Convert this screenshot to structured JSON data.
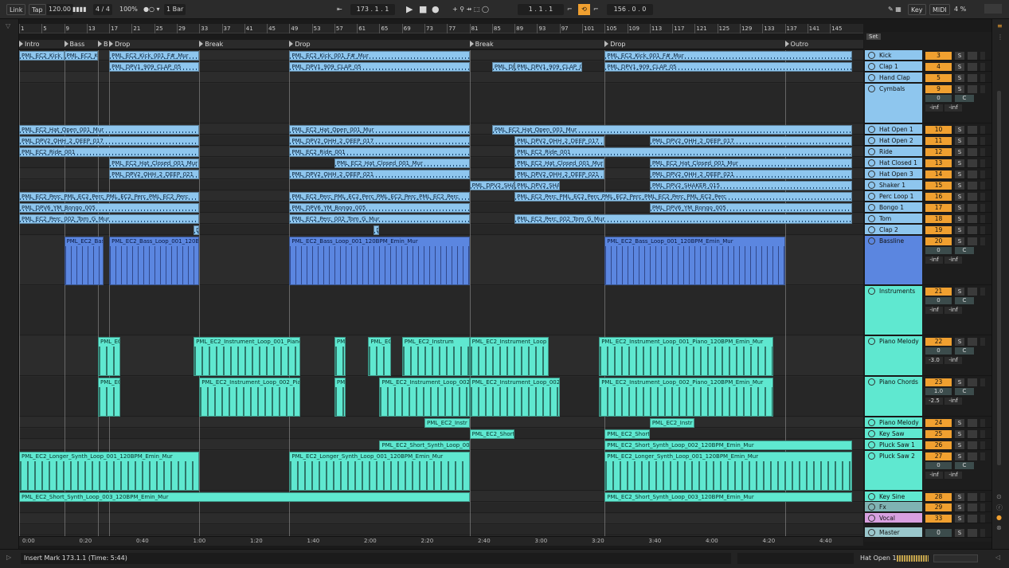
{
  "topbar": {
    "link": "Link",
    "tap": "Tap",
    "tempo": "120.00",
    "signature": "4 / 4",
    "zoom": "100%",
    "quant": "1 Bar",
    "position": "173 .  1 .  1",
    "loop_start": "1 .  1 .  1",
    "loop_len": "156 .  0 .  0",
    "key": "Key",
    "midi": "MIDI",
    "cpu": "4 %"
  },
  "ruler": {
    "bars": [
      "1",
      "5",
      "9",
      "13",
      "17",
      "21",
      "25",
      "29",
      "33",
      "37",
      "41",
      "45",
      "49",
      "53",
      "57",
      "61",
      "65",
      "69",
      "73",
      "77",
      "81",
      "85",
      "89",
      "93",
      "97",
      "101",
      "105",
      "109",
      "113",
      "117",
      "121",
      "125",
      "129",
      "133",
      "137",
      "141",
      "145"
    ]
  },
  "locators": [
    {
      "label": "Intro",
      "bar": 1
    },
    {
      "label": "Bass",
      "bar": 9
    },
    {
      "label": "B",
      "bar": 15
    },
    {
      "label": "Drop",
      "bar": 17
    },
    {
      "label": "Break",
      "bar": 33
    },
    {
      "label": "Drop",
      "bar": 49
    },
    {
      "label": "Break",
      "bar": 81
    },
    {
      "label": "Drop",
      "bar": 105
    },
    {
      "label": "Outro",
      "bar": 137
    }
  ],
  "time_axis": [
    "0:00",
    "0:20",
    "0:40",
    "1:00",
    "1:20",
    "1:40",
    "2:00",
    "2:20",
    "2:40",
    "3:00",
    "3:20",
    "3:40",
    "4:00",
    "4:20",
    "4:40"
  ],
  "clips": [
    {
      "lane": 0,
      "from": 1,
      "to": 9,
      "name": "PML_EC2_Kick",
      "kind": "blue"
    },
    {
      "lane": 0,
      "from": 9,
      "to": 15,
      "name": "PML_EC2_K",
      "kind": "blue"
    },
    {
      "lane": 0,
      "from": 17,
      "to": 33,
      "name": "PML_EC2_Kick_001_F#_Mur",
      "kind": "blue"
    },
    {
      "lane": 0,
      "from": 49,
      "to": 81,
      "name": "PML_EC2_Kick_001_F#_Mur",
      "kind": "blue"
    },
    {
      "lane": 0,
      "from": 105,
      "to": 149,
      "name": "PML_EC2_Kick_001_F#_Mur",
      "kind": "blue"
    },
    {
      "lane": 1,
      "from": 17,
      "to": 33,
      "name": "PML_DPV1_909_CLAP_05",
      "kind": "blue"
    },
    {
      "lane": 1,
      "from": 49,
      "to": 81,
      "name": "PML_DPV1_909_CLAP_05",
      "kind": "blue"
    },
    {
      "lane": 1,
      "from": 85,
      "to": 89,
      "name": "PML_DPV1_909_CLAP_05",
      "kind": "blue"
    },
    {
      "lane": 1,
      "from": 89,
      "to": 101,
      "name": "PML_DPV1_909_CLAP_05",
      "kind": "blue"
    },
    {
      "lane": 1,
      "from": 105,
      "to": 149,
      "name": "PML_DPV1_909_CLAP_05",
      "kind": "blue"
    },
    {
      "lane": 4,
      "from": 1,
      "to": 33,
      "name": "PML_EC2_Hat_Open_001_Mur",
      "kind": "blue"
    },
    {
      "lane": 4,
      "from": 49,
      "to": 81,
      "name": "PML_EC2_Hat_Open_001_Mur",
      "kind": "blue"
    },
    {
      "lane": 4,
      "from": 85,
      "to": 149,
      "name": "PML_EC2_Hat_Open_001_Mur",
      "kind": "blue"
    },
    {
      "lane": 5,
      "from": 1,
      "to": 33,
      "name": "PML_DPV2_OHH_2_DEEP_017",
      "kind": "blue"
    },
    {
      "lane": 5,
      "from": 49,
      "to": 81,
      "name": "PML_DPV2_OHH_2_DEEP_017",
      "kind": "blue"
    },
    {
      "lane": 5,
      "from": 89,
      "to": 105,
      "name": "PML_DPV2_OHH_2_DEEP_017",
      "kind": "blue"
    },
    {
      "lane": 5,
      "from": 113,
      "to": 149,
      "name": "PML_DPV2_OHH_2_DEEP_017",
      "kind": "blue"
    },
    {
      "lane": 6,
      "from": 1,
      "to": 33,
      "name": "PML_EC2_Ride_001",
      "kind": "blue"
    },
    {
      "lane": 6,
      "from": 49,
      "to": 81,
      "name": "PML_EC2_Ride_001",
      "kind": "blue"
    },
    {
      "lane": 6,
      "from": 89,
      "to": 149,
      "name": "PML_EC2_Ride_001",
      "kind": "blue"
    },
    {
      "lane": 7,
      "from": 17,
      "to": 33,
      "name": "PML_EC2_Hat_Closed_001_Mur",
      "kind": "blue"
    },
    {
      "lane": 7,
      "from": 57,
      "to": 81,
      "name": "PML_EC2_Hat_Closed_001_Mur",
      "kind": "blue"
    },
    {
      "lane": 7,
      "from": 89,
      "to": 105,
      "name": "PML_EC2_Hat_Closed_001_Mur",
      "kind": "blue"
    },
    {
      "lane": 7,
      "from": 113,
      "to": 149,
      "name": "PML_EC2_Hat_Closed_001_Mur",
      "kind": "blue"
    },
    {
      "lane": 8,
      "from": 17,
      "to": 33,
      "name": "PML_DPV2_OHH_2_DEEP_021",
      "kind": "blue"
    },
    {
      "lane": 8,
      "from": 49,
      "to": 81,
      "name": "PML_DPV2_OHH_2_DEEP_021",
      "kind": "blue"
    },
    {
      "lane": 8,
      "from": 89,
      "to": 105,
      "name": "PML_DPV2_OHH_2_DEEP_021",
      "kind": "blue"
    },
    {
      "lane": 8,
      "from": 113,
      "to": 149,
      "name": "PML_DPV2_OHH_2_DEEP_021",
      "kind": "blue"
    },
    {
      "lane": 9,
      "from": 81,
      "to": 89,
      "name": "PML_DPV2_SHA",
      "kind": "blue"
    },
    {
      "lane": 9,
      "from": 89,
      "to": 97,
      "name": "PML_DPV2_SHA",
      "kind": "blue"
    },
    {
      "lane": 9,
      "from": 113,
      "to": 149,
      "name": "PML_DPV2_SHAKER_015",
      "kind": "blue"
    },
    {
      "lane": 10,
      "from": 1,
      "to": 33,
      "name": "PML_EC2_Perc_PML_EC2_Perc_PML_EC2_Perc_PML_EC2_Perc",
      "kind": "blue"
    },
    {
      "lane": 10,
      "from": 49,
      "to": 81,
      "name": "PML_EC2_Perc_PML_EC2_Perc_PML_EC2_Perc_PML_EC2_Perc",
      "kind": "blue"
    },
    {
      "lane": 10,
      "from": 89,
      "to": 149,
      "name": "PML_EC2_Perc_PML_EC2_Perc_PML_EC2_Perc_PML_EC2_Perc_PML_EC2_Perc",
      "kind": "blue"
    },
    {
      "lane": 11,
      "from": 1,
      "to": 33,
      "name": "PML_DPV6_YM_Bongo_005",
      "kind": "blue"
    },
    {
      "lane": 11,
      "from": 49,
      "to": 81,
      "name": "PML_DPV6_YM_Bongo_005",
      "kind": "blue"
    },
    {
      "lane": 11,
      "from": 113,
      "to": 149,
      "name": "PML_DPV6_YM_Bongo_005",
      "kind": "blue"
    },
    {
      "lane": 12,
      "from": 1,
      "to": 33,
      "name": "PML_EC2_Perc_002_Tom_G_Mur",
      "kind": "blue"
    },
    {
      "lane": 12,
      "from": 49,
      "to": 81,
      "name": "PML_EC2_Perc_002_Tom_G_Mur",
      "kind": "blue"
    },
    {
      "lane": 12,
      "from": 89,
      "to": 149,
      "name": "PML_EC2_Perc_002_Tom_G_Mur",
      "kind": "blue"
    },
    {
      "lane": 13,
      "from": 32,
      "to": 33,
      "name": "D",
      "kind": "blue"
    },
    {
      "lane": 13,
      "from": 64,
      "to": 65,
      "name": "D",
      "kind": "blue"
    },
    {
      "lane": 14,
      "from": 9,
      "to": 16,
      "name": "PML_EC2_Bas",
      "kind": "bass"
    },
    {
      "lane": 14,
      "from": 17,
      "to": 33,
      "name": "PML_EC2_Bass_Loop_001_120BPM",
      "kind": "bass"
    },
    {
      "lane": 14,
      "from": 49,
      "to": 81,
      "name": "PML_EC2_Bass_Loop_001_120BPM_Emin_Mur",
      "kind": "bass"
    },
    {
      "lane": 14,
      "from": 105,
      "to": 137,
      "name": "PML_EC2_Bass_Loop_001_120BPM_Emin_Mur",
      "kind": "bass"
    },
    {
      "lane": 16,
      "from": 15,
      "to": 19,
      "name": "PML_EC",
      "kind": "teal"
    },
    {
      "lane": 16,
      "from": 32,
      "to": 51,
      "name": "PML_EC2_Instrument_Loop_001_Piano",
      "kind": "teal"
    },
    {
      "lane": 16,
      "from": 57,
      "to": 59,
      "name": "PMI",
      "kind": "teal"
    },
    {
      "lane": 16,
      "from": 63,
      "to": 67,
      "name": "PML_EC",
      "kind": "teal"
    },
    {
      "lane": 16,
      "from": 69,
      "to": 81,
      "name": "PML_EC2_Instrum",
      "kind": "teal"
    },
    {
      "lane": 16,
      "from": 81,
      "to": 95,
      "name": "PML_EC2_Instrument_Loop",
      "kind": "teal"
    },
    {
      "lane": 16,
      "from": 104,
      "to": 135,
      "name": "PML_EC2_Instrument_Loop_001_Piano_120BPM_Emin_Mur",
      "kind": "teal"
    },
    {
      "lane": 17,
      "from": 15,
      "to": 19,
      "name": "PML_EC",
      "kind": "teal"
    },
    {
      "lane": 17,
      "from": 33,
      "to": 51,
      "name": "PML_EC2_Instrument_Loop_002_Pia",
      "kind": "teal"
    },
    {
      "lane": 17,
      "from": 57,
      "to": 59,
      "name": "PMI",
      "kind": "teal"
    },
    {
      "lane": 17,
      "from": 65,
      "to": 81,
      "name": "PML_EC2_Instrument_Loop_002",
      "kind": "teal"
    },
    {
      "lane": 17,
      "from": 81,
      "to": 97,
      "name": "PML_EC2_Instrument_Loop_002",
      "kind": "teal"
    },
    {
      "lane": 17,
      "from": 104,
      "to": 135,
      "name": "PML_EC2_Instrument_Loop_002_Piano_120BPM_Emin_Mur",
      "kind": "teal"
    },
    {
      "lane": 18,
      "from": 73,
      "to": 81,
      "name": "PML_EC2_Instr",
      "kind": "teal"
    },
    {
      "lane": 18,
      "from": 113,
      "to": 121,
      "name": "PML_EC2_Instr",
      "kind": "teal"
    },
    {
      "lane": 19,
      "from": 81,
      "to": 89,
      "name": "PML_EC2_Short",
      "kind": "teal"
    },
    {
      "lane": 19,
      "from": 105,
      "to": 113,
      "name": "PML_EC2_Short",
      "kind": "teal"
    },
    {
      "lane": 20,
      "from": 65,
      "to": 81,
      "name": "PML_EC2_Short_Synth_Loop_00",
      "kind": "teal"
    },
    {
      "lane": 20,
      "from": 105,
      "to": 149,
      "name": "PML_EC2_Short_Synth_Loop_002_120BPM_Emin_Mur",
      "kind": "teal"
    },
    {
      "lane": 21,
      "from": 1,
      "to": 33,
      "name": "PML_EC2_Longer_Synth_Loop_001_120BPM_Emin_Mur",
      "kind": "teal"
    },
    {
      "lane": 21,
      "from": 49,
      "to": 81,
      "name": "PML_EC2_Longer_Synth_Loop_001_120BPM_Emin_Mur",
      "kind": "teal"
    },
    {
      "lane": 21,
      "from": 105,
      "to": 149,
      "name": "PML_EC2_Longer_Synth_Loop_001_120BPM_Emin_Mur",
      "kind": "teal"
    },
    {
      "lane": 22,
      "from": 1,
      "to": 81,
      "name": "PML_EC2_Short_Synth_Loop_003_120BPM_Emin_Mur",
      "kind": "teal"
    },
    {
      "lane": 22,
      "from": 105,
      "to": 149,
      "name": "PML_EC2_Short_Synth_Loop_003_120BPM_Emin_Mur",
      "kind": "teal"
    }
  ],
  "tracks": [
    {
      "name": "Kick",
      "num": "3",
      "color": "#8ec6ee"
    },
    {
      "name": "Clap 1",
      "num": "4",
      "color": "#8ec6ee"
    },
    {
      "name": "Hand Clap",
      "num": "5",
      "color": "#8ec6ee"
    },
    {
      "name": "Cymbals",
      "num": "9",
      "color": "#8ec6ee",
      "vol": "0",
      "pan": "C",
      "inf1": "-inf",
      "inf2": "-inf"
    },
    {
      "name": "Hat Open 1",
      "num": "10",
      "color": "#8ec6ee"
    },
    {
      "name": "Hat Open 2",
      "num": "11",
      "color": "#8ec6ee"
    },
    {
      "name": "Ride",
      "num": "12",
      "color": "#8ec6ee"
    },
    {
      "name": "Hat Closed 1",
      "num": "13",
      "color": "#8ec6ee"
    },
    {
      "name": "Hat Open 3",
      "num": "14",
      "color": "#8ec6ee"
    },
    {
      "name": "Shaker 1",
      "num": "15",
      "color": "#8ec6ee"
    },
    {
      "name": "Perc Loop 1",
      "num": "16",
      "color": "#8ec6ee"
    },
    {
      "name": "Bongo 1",
      "num": "17",
      "color": "#8ec6ee"
    },
    {
      "name": "Tom",
      "num": "18",
      "color": "#8ec6ee"
    },
    {
      "name": "Clap 2",
      "num": "19",
      "color": "#8ec6ee"
    },
    {
      "name": "Bassline",
      "num": "20",
      "color": "#5b86e0",
      "vol": "0",
      "pan": "C",
      "inf1": "-inf",
      "inf2": "-inf"
    },
    {
      "name": "Instruments",
      "num": "21",
      "color": "#5fe8d0",
      "vol": "0",
      "pan": "C",
      "inf1": "-inf",
      "inf2": "-inf"
    },
    {
      "name": "Piano Melody",
      "num": "22",
      "color": "#5fe8d0",
      "vol": "0",
      "pan": "C",
      "inf1": "-3.0",
      "inf2": "-inf"
    },
    {
      "name": "Piano Chords",
      "num": "23",
      "color": "#5fe8d0",
      "vol": "1.0",
      "pan": "C",
      "inf1": "-2.5",
      "inf2": "-inf"
    },
    {
      "name": "Piano Melody",
      "num": "24",
      "color": "#5fe8d0"
    },
    {
      "name": "Key Saw",
      "num": "25",
      "color": "#5fe8d0"
    },
    {
      "name": "Pluck Saw 1",
      "num": "26",
      "color": "#5fe8d0"
    },
    {
      "name": "Pluck Saw 2",
      "num": "27",
      "color": "#5fe8d0",
      "vol": "0",
      "pan": "C",
      "inf1": "-inf",
      "inf2": "-inf"
    },
    {
      "name": "Key Sine",
      "num": "28",
      "color": "#5fe8d0"
    },
    {
      "name": "Fx",
      "num": "29",
      "color": "#7fb3b3"
    },
    {
      "name": "Vocal",
      "num": "33",
      "color": "#d8a0e0"
    },
    {
      "name": "Master",
      "num": "0",
      "color": "#9ac7cc"
    }
  ],
  "mixer": {
    "set": "Set",
    "solo": "S"
  },
  "status": {
    "message": "Insert Mark 173.1.1 (Time: 5:44)",
    "selected_track": "Hat Open 1"
  }
}
